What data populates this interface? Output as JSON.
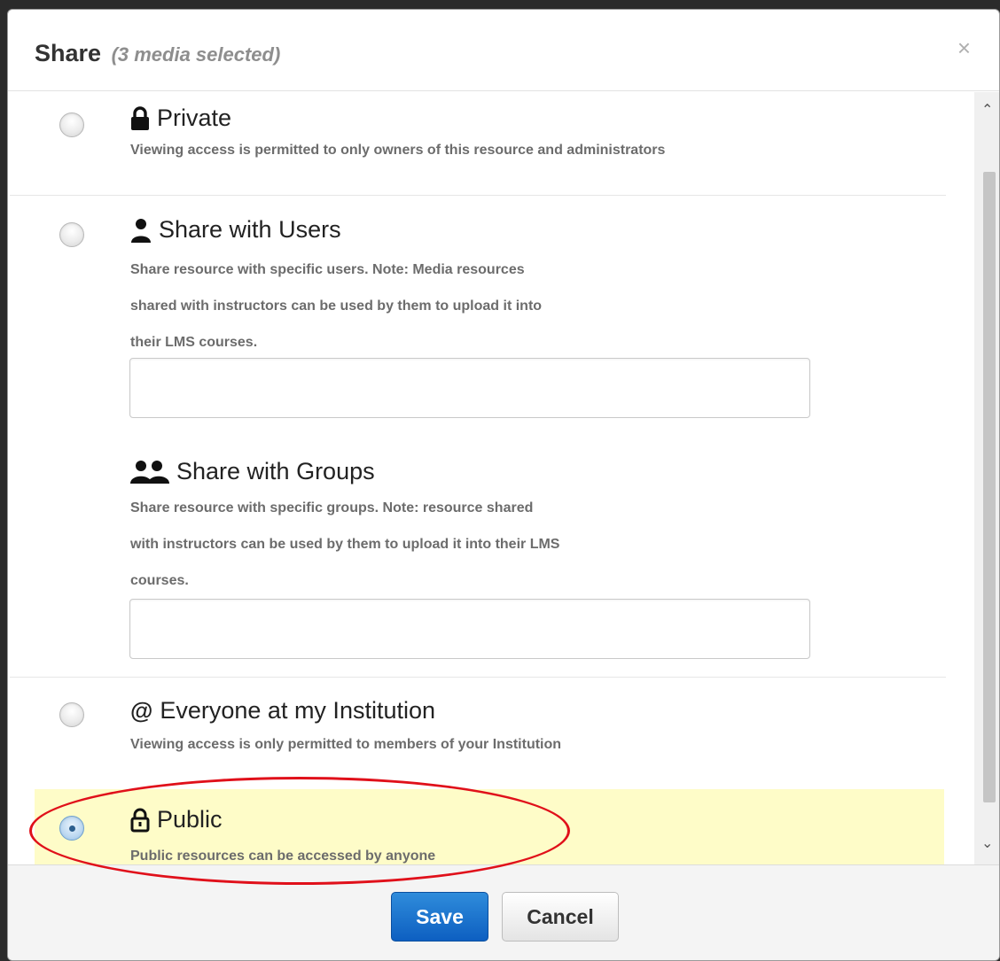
{
  "dialog": {
    "title": "Share",
    "subtitle": "(3 media selected)",
    "close_symbol": "×"
  },
  "options": {
    "private": {
      "icon": "lock-icon",
      "label": "Private",
      "description": "Viewing access is permitted to only owners of this resource and administrators",
      "checked": false
    },
    "users": {
      "icon": "user-icon",
      "label": "Share with Users",
      "description_lines": [
        "Share resource with specific users. Note: Media resources",
        "shared with instructors can be used by them to upload it into",
        "their LMS courses."
      ],
      "input_value": "",
      "checked": false
    },
    "groups": {
      "icon": "group-icon",
      "label": "Share with Groups",
      "description_lines": [
        "Share resource with specific groups. Note: resource shared",
        "with instructors can be used by them to upload it into their LMS",
        "courses."
      ],
      "input_value": ""
    },
    "institution": {
      "icon": "at-icon",
      "label": "Everyone at my Institution",
      "description": "Viewing access is only permitted to members of your Institution",
      "checked": false
    },
    "public": {
      "icon": "unlock-icon",
      "label": "Public",
      "description": "Public resources can be accessed by anyone",
      "checked": true
    }
  },
  "scrollbar": {
    "up": "⌃",
    "down": "⌄"
  },
  "footer": {
    "save_label": "Save",
    "cancel_label": "Cancel"
  },
  "colors": {
    "selected_bg": "#fefcc8",
    "primary_button": "#0d5fc1",
    "annotation": "#e0101a"
  }
}
